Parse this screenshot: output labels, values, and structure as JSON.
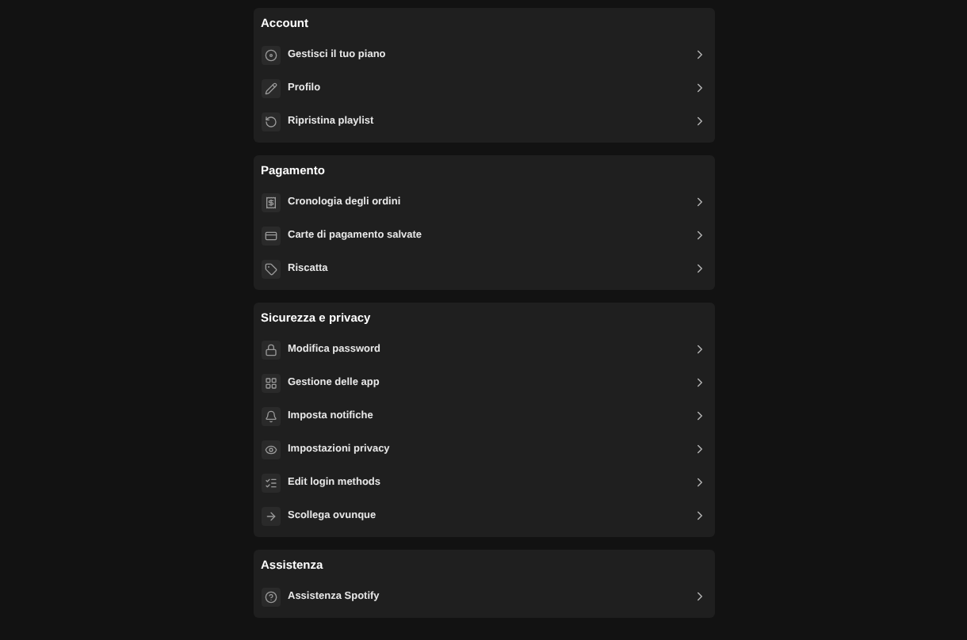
{
  "sections": [
    {
      "title": "Account",
      "items": [
        {
          "label": "Gestisci il tuo piano"
        },
        {
          "label": "Profilo"
        },
        {
          "label": "Ripristina playlist"
        }
      ]
    },
    {
      "title": "Pagamento",
      "items": [
        {
          "label": "Cronologia degli ordini"
        },
        {
          "label": "Carte di pagamento salvate"
        },
        {
          "label": "Riscatta"
        }
      ]
    },
    {
      "title": "Sicurezza e privacy",
      "items": [
        {
          "label": "Modifica password"
        },
        {
          "label": "Gestione delle app"
        },
        {
          "label": "Imposta notifiche"
        },
        {
          "label": "Impostazioni privacy"
        },
        {
          "label": "Edit login methods"
        },
        {
          "label": "Scollega ovunque"
        }
      ]
    },
    {
      "title": "Assistenza",
      "items": [
        {
          "label": "Assistenza Spotify"
        }
      ]
    }
  ]
}
